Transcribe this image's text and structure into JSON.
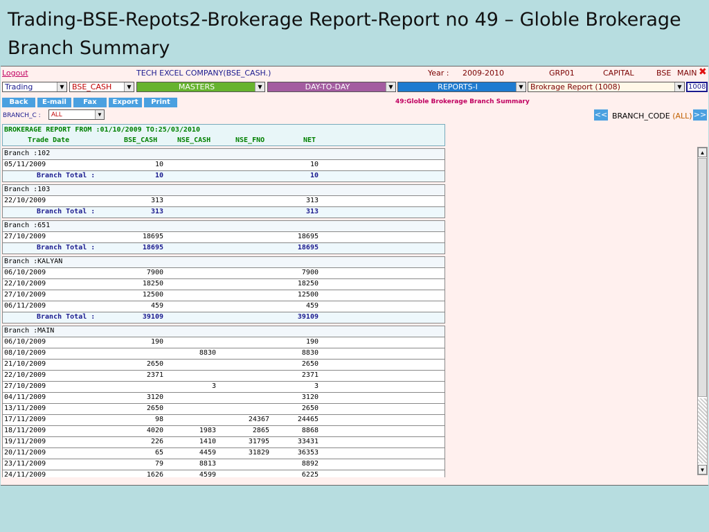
{
  "slide": {
    "title": "Trading-BSE-Repots2-Brokerage Report-Report no 49 – Globle Brokerage Branch Summary"
  },
  "topbar": {
    "logout": "Logout",
    "company": "TECH EXCEL COMPANY(BSE_CASH.)",
    "year_label": "Year :",
    "year": "2009-2010",
    "group": "GRP01",
    "capital": "CAPITAL",
    "exchange": "BSE",
    "main": "MAIN",
    "close_glyph": "✖"
  },
  "menus": {
    "trading": "Trading",
    "bse_cash": "BSE_CASH",
    "masters": "MASTERS",
    "day_to_day": "DAY-TO-DAY",
    "reports": "REPORTS-I",
    "report_select": "Brokrage Report (1008)",
    "report_code": "1008"
  },
  "colors": {
    "masters": "#66b32e",
    "day_to_day": "#a35ca0",
    "reports": "#1e7bd0"
  },
  "toolbar": {
    "back": "Back",
    "email": "E-mail",
    "fax": "Fax",
    "export": "Export",
    "print": "Print"
  },
  "report_name": "49:Globle Brokerage Branch Summary",
  "filter": {
    "label": "BRANCH_C :",
    "value": "ALL",
    "prev": "<<",
    "next": ">>",
    "branch_code_label": "BRANCH_CODE",
    "branch_code_value": "(ALL)"
  },
  "grid": {
    "title": "BROKERAGE REPORT FROM :01/10/2009 TO:25/03/2010",
    "columns": {
      "date": "Trade Date",
      "bse": "BSE_CASH",
      "nse": "NSE_CASH",
      "fno": "NSE_FNO",
      "net": "NET"
    },
    "total_label": "Branch Total :",
    "rows": [
      {
        "type": "branch",
        "label": "Branch :102"
      },
      {
        "type": "data",
        "date": "05/11/2009",
        "bse": "10",
        "nse": "",
        "fno": "",
        "net": "10"
      },
      {
        "type": "total",
        "bse": "10",
        "nse": "",
        "fno": "",
        "net": "10"
      },
      {
        "type": "branch",
        "label": "Branch :103"
      },
      {
        "type": "data",
        "date": "22/10/2009",
        "bse": "313",
        "nse": "",
        "fno": "",
        "net": "313"
      },
      {
        "type": "total",
        "bse": "313",
        "nse": "",
        "fno": "",
        "net": "313"
      },
      {
        "type": "branch",
        "label": "Branch :651"
      },
      {
        "type": "data",
        "date": "27/10/2009",
        "bse": "18695",
        "nse": "",
        "fno": "",
        "net": "18695"
      },
      {
        "type": "total",
        "bse": "18695",
        "nse": "",
        "fno": "",
        "net": "18695"
      },
      {
        "type": "branch",
        "label": "Branch :KALYAN"
      },
      {
        "type": "data",
        "date": "06/10/2009",
        "bse": "7900",
        "nse": "",
        "fno": "",
        "net": "7900"
      },
      {
        "type": "data",
        "date": "22/10/2009",
        "bse": "18250",
        "nse": "",
        "fno": "",
        "net": "18250"
      },
      {
        "type": "data",
        "date": "27/10/2009",
        "bse": "12500",
        "nse": "",
        "fno": "",
        "net": "12500"
      },
      {
        "type": "data",
        "date": "06/11/2009",
        "bse": "459",
        "nse": "",
        "fno": "",
        "net": "459"
      },
      {
        "type": "total",
        "bse": "39109",
        "nse": "",
        "fno": "",
        "net": "39109"
      },
      {
        "type": "branch",
        "label": "Branch :MAIN"
      },
      {
        "type": "data",
        "date": "06/10/2009",
        "bse": "190",
        "nse": "",
        "fno": "",
        "net": "190"
      },
      {
        "type": "data",
        "date": "08/10/2009",
        "bse": "",
        "nse": "8830",
        "fno": "",
        "net": "8830"
      },
      {
        "type": "data",
        "date": "21/10/2009",
        "bse": "2650",
        "nse": "",
        "fno": "",
        "net": "2650"
      },
      {
        "type": "data",
        "date": "22/10/2009",
        "bse": "2371",
        "nse": "",
        "fno": "",
        "net": "2371"
      },
      {
        "type": "data",
        "date": "27/10/2009",
        "bse": "",
        "nse": "3",
        "fno": "",
        "net": "3"
      },
      {
        "type": "data",
        "date": "04/11/2009",
        "bse": "3120",
        "nse": "",
        "fno": "",
        "net": "3120"
      },
      {
        "type": "data",
        "date": "13/11/2009",
        "bse": "2650",
        "nse": "",
        "fno": "",
        "net": "2650"
      },
      {
        "type": "data",
        "date": "17/11/2009",
        "bse": "98",
        "nse": "",
        "fno": "24367",
        "net": "24465"
      },
      {
        "type": "data",
        "date": "18/11/2009",
        "bse": "4020",
        "nse": "1983",
        "fno": "2865",
        "net": "8868"
      },
      {
        "type": "data",
        "date": "19/11/2009",
        "bse": "226",
        "nse": "1410",
        "fno": "31795",
        "net": "33431"
      },
      {
        "type": "data",
        "date": "20/11/2009",
        "bse": "65",
        "nse": "4459",
        "fno": "31829",
        "net": "36353"
      },
      {
        "type": "data",
        "date": "23/11/2009",
        "bse": "79",
        "nse": "8813",
        "fno": "",
        "net": "8892"
      },
      {
        "type": "data",
        "date": "24/11/2009",
        "bse": "1626",
        "nse": "4599",
        "fno": "",
        "net": "6225"
      }
    ]
  },
  "icons": {
    "dropdown": "chevron-down-icon",
    "close": "close-icon",
    "scroll_up": "arrow-up-icon",
    "scroll_down": "arrow-down-icon"
  }
}
